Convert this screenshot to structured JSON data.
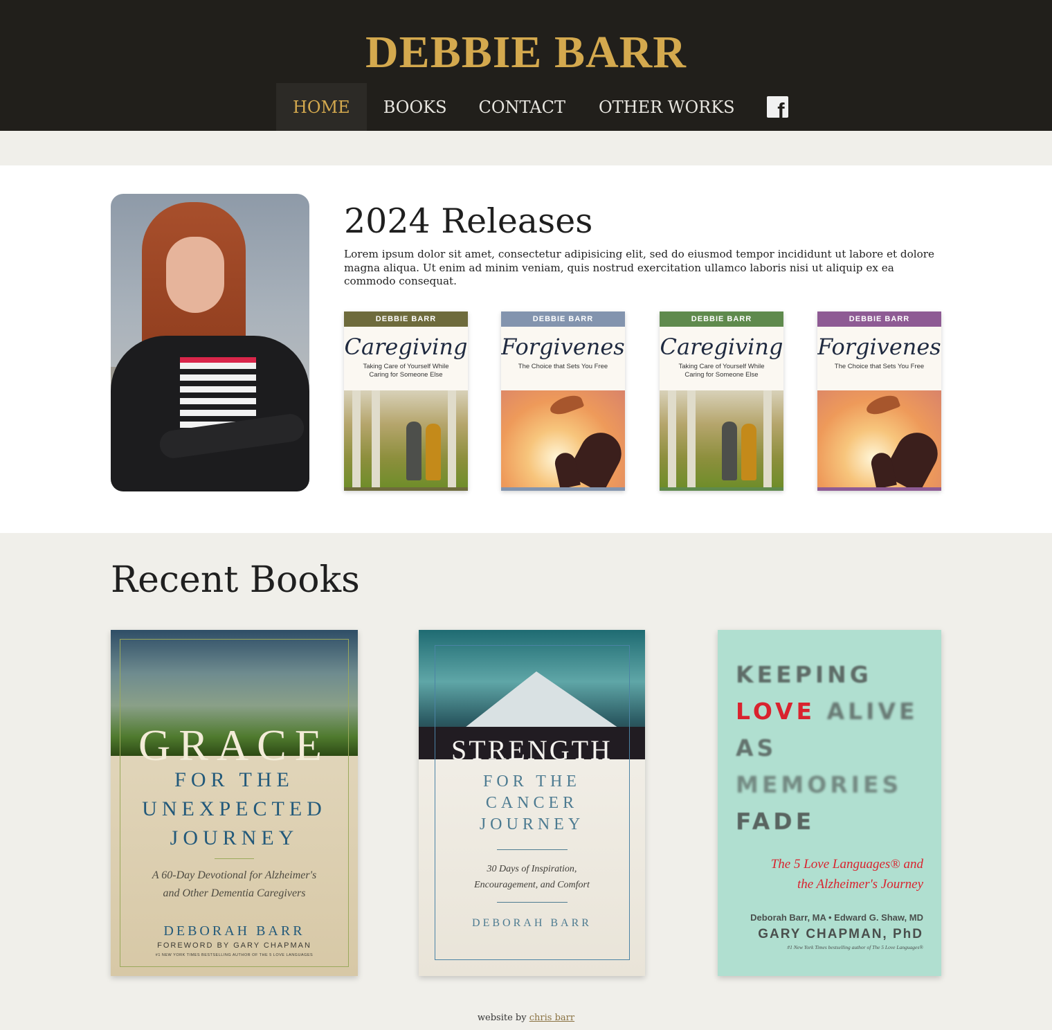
{
  "site": {
    "title": "DEBBIE BARR"
  },
  "nav": {
    "items": [
      {
        "label": "HOME",
        "active": true
      },
      {
        "label": "BOOKS"
      },
      {
        "label": "CONTACT"
      },
      {
        "label": "OTHER WORKS"
      }
    ],
    "facebook_icon": "facebook-icon"
  },
  "releases": {
    "title": "2024 Releases",
    "description": "Lorem ipsum dolor sit amet, consectetur adipisicing elit, sed do eiusmod tempor incididunt ut labore et dolore magna aliqua. Ut enim ad minim veniam, quis nostrud exercitation ullamco laboris nisi ut aliquip ex ea commodo consequat.",
    "books": [
      {
        "band": "DEBBIE BARR",
        "title": "Caregiving",
        "subtitle": "Taking Care of Yourself While Caring for Someone Else",
        "color": "#6e6b3c"
      },
      {
        "band": "DEBBIE BARR",
        "title": "Forgiveness",
        "subtitle": "The Choice that Sets You Free",
        "color": "#8394ae"
      },
      {
        "band": "DEBBIE BARR",
        "title": "Caregiving",
        "subtitle": "Taking Care of Yourself While Caring for Someone Else",
        "color": "#5f8a4d"
      },
      {
        "band": "DEBBIE BARR",
        "title": "Forgiveness",
        "subtitle": "The Choice that Sets You Free",
        "color": "#8e5b94"
      }
    ]
  },
  "recent": {
    "title": "Recent Books",
    "grace": {
      "word": "GRACE",
      "sub1": "FOR THE",
      "sub2": "UNEXPECTED",
      "sub3": "JOURNEY",
      "italic1": "A 60-Day Devotional for Alzheimer's",
      "italic2": "and Other Dementia Caregivers",
      "author": "DEBORAH BARR",
      "foreword": "FOREWORD BY GARY CHAPMAN",
      "tiny": "#1 NEW YORK TIMES BESTSELLING AUTHOR OF THE 5 LOVE LANGUAGES"
    },
    "strength": {
      "word": "STRENGTH",
      "sub1": "FOR THE",
      "sub2": "CANCER",
      "sub3": "JOURNEY",
      "italic1": "30 Days of Inspiration,",
      "italic2": "Encouragement, and Comfort",
      "author": "DEBORAH BARR"
    },
    "keeping": {
      "line1": "KEEPING",
      "line2a": "LOVE",
      "line2b": "ALIVE",
      "line3": "AS",
      "line4": "MEMORIES",
      "line5": "FADE",
      "italic1": "The 5 Love Languages® and",
      "italic2": "the Alzheimer's Journey",
      "authors": "Deborah Barr, MA • Edward G. Shaw, MD",
      "gary": "GARY CHAPMAN, PhD",
      "tiny": "#1 New York Times bestselling author of The 5 Love Languages®"
    }
  },
  "footer": {
    "prefix": "website by",
    "link": "chris barr"
  }
}
